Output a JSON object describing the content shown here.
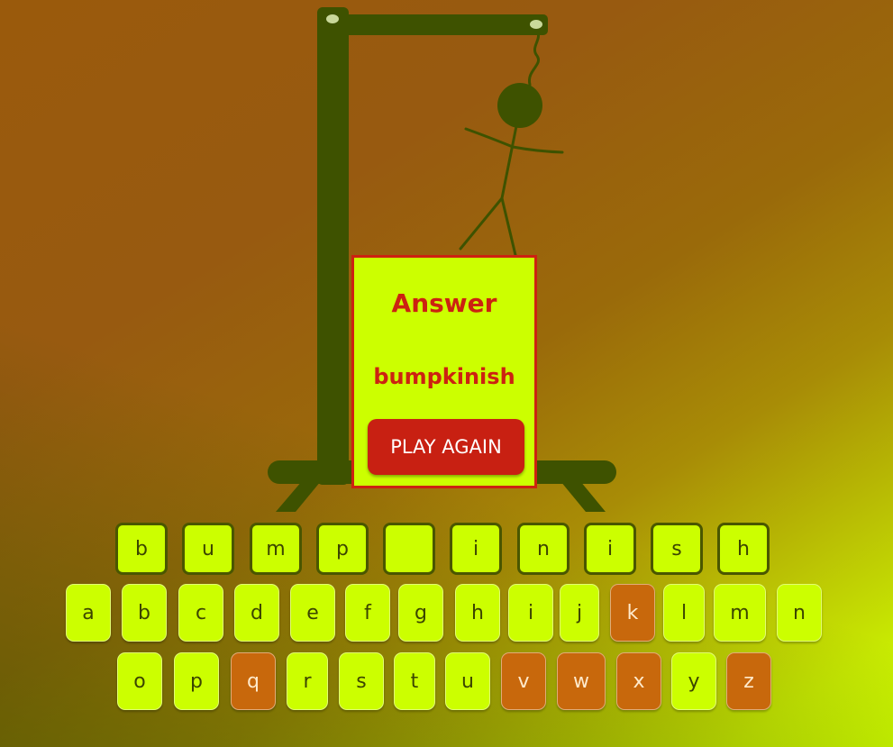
{
  "colors": {
    "frame": "#3e5200",
    "accent": "#ccff00",
    "answer_red": "#cc2211",
    "used_key": "#c8680c"
  },
  "answer_card": {
    "title": "Answer",
    "word": "bumpkinish",
    "button_label": "PLAY AGAIN"
  },
  "word_slots": [
    "b",
    "u",
    "m",
    "p",
    "",
    "i",
    "n",
    "i",
    "s",
    "h"
  ],
  "keyboard": {
    "row1": [
      {
        "letter": "a",
        "state": "available"
      },
      {
        "letter": "b",
        "state": "available"
      },
      {
        "letter": "c",
        "state": "available"
      },
      {
        "letter": "d",
        "state": "available"
      },
      {
        "letter": "e",
        "state": "available"
      },
      {
        "letter": "f",
        "state": "available"
      },
      {
        "letter": "g",
        "state": "available"
      },
      {
        "letter": "h",
        "state": "available"
      },
      {
        "letter": "i",
        "state": "available"
      },
      {
        "letter": "j",
        "state": "available"
      },
      {
        "letter": "k",
        "state": "used"
      },
      {
        "letter": "l",
        "state": "available"
      },
      {
        "letter": "m",
        "state": "available"
      },
      {
        "letter": "n",
        "state": "available"
      }
    ],
    "row2": [
      {
        "letter": "o",
        "state": "available"
      },
      {
        "letter": "p",
        "state": "available"
      },
      {
        "letter": "q",
        "state": "used"
      },
      {
        "letter": "r",
        "state": "available"
      },
      {
        "letter": "s",
        "state": "available"
      },
      {
        "letter": "t",
        "state": "available"
      },
      {
        "letter": "u",
        "state": "available"
      },
      {
        "letter": "v",
        "state": "used"
      },
      {
        "letter": "w",
        "state": "used"
      },
      {
        "letter": "x",
        "state": "used"
      },
      {
        "letter": "y",
        "state": "available"
      },
      {
        "letter": "z",
        "state": "used"
      }
    ]
  }
}
